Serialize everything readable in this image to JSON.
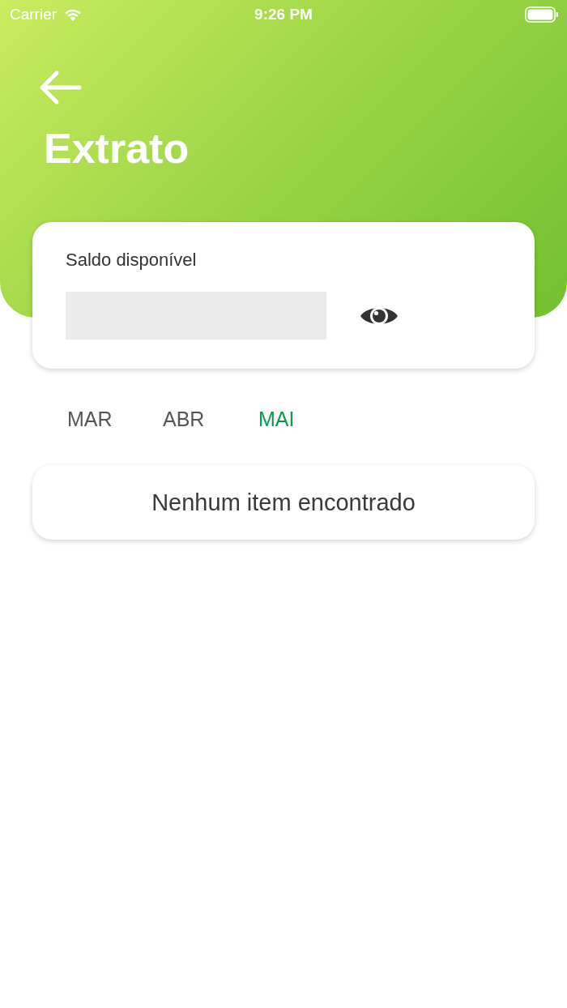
{
  "status_bar": {
    "carrier": "Carrier",
    "time": "9:26 PM"
  },
  "header": {
    "title": "Extrato"
  },
  "balance": {
    "label": "Saldo disponível"
  },
  "months": [
    {
      "label": "MAR",
      "selected": false
    },
    {
      "label": "ABR",
      "selected": false
    },
    {
      "label": "MAI",
      "selected": true
    }
  ],
  "empty_message": "Nenhum item encontrado"
}
